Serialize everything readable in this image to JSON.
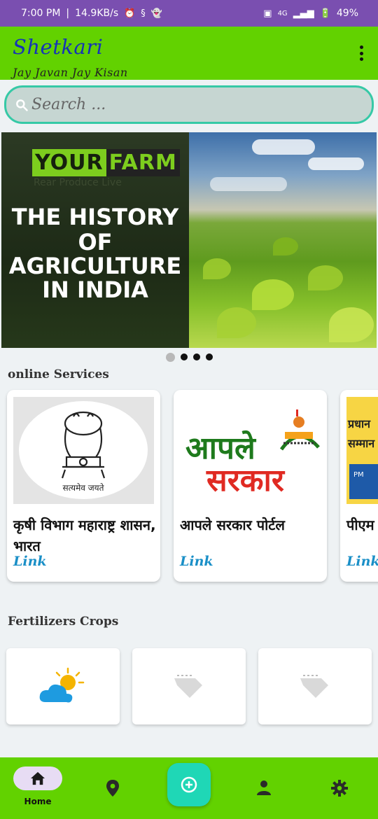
{
  "status_bar": {
    "time": "7:00 PM",
    "net_speed": "14.9KB/s",
    "signal": "4G",
    "battery": "49%"
  },
  "app_bar": {
    "title": "Shetkari",
    "subtitle": "Jay Javan Jay Kisan",
    "menu_icon": "more-vert-icon"
  },
  "search": {
    "placeholder": "Search ...",
    "value": "",
    "icon": "search-icon"
  },
  "banner": {
    "brand_left": "YOUR",
    "brand_right": "FARM",
    "brand_tagline": "Rear Produce Live",
    "headline": [
      "THE HISTORY",
      "OF",
      "AGRICULTURE",
      "IN INDIA"
    ],
    "pager": {
      "total": 4,
      "active": 0
    }
  },
  "online_services": {
    "title": "online Services",
    "items": [
      {
        "name": "कृषी विभाग महाराष्ट्र शासन, भारत",
        "link": "Link",
        "image": "emblem-of-india",
        "image_caption": "सत्यमेव जयते"
      },
      {
        "name": "आपले सरकार पोर्टल",
        "link": "Link",
        "image": "aaple-sarkar-logo",
        "logo_line1": "आपले",
        "logo_line2": "सरकार"
      },
      {
        "name": "पीएम निधी",
        "link": "Link",
        "image": "pm-kisan-logo",
        "logo_line1": "प्रधान",
        "logo_line2": "सम्मान"
      }
    ]
  },
  "fertilizers_crops": {
    "title": "Fertilizers Crops",
    "items": [
      {
        "icon": "weather-icon"
      },
      {
        "icon": "broken-image-icon"
      },
      {
        "icon": "broken-image-icon"
      }
    ]
  },
  "bottom_nav": {
    "items": [
      {
        "label": "Home",
        "icon": "home-icon",
        "active": true
      },
      {
        "label": "",
        "icon": "location-icon"
      },
      {
        "label": "",
        "icon": "add-circle-icon",
        "fab": true
      },
      {
        "label": "",
        "icon": "person-icon"
      },
      {
        "label": "",
        "icon": "settings-icon"
      }
    ]
  },
  "colors": {
    "status_bar": "#7a4fb0",
    "app_bar": "#62d200",
    "title": "#1533b8",
    "search_border": "#36c9a6",
    "link": "#1a8fc7",
    "fab": "#1fd7b6"
  }
}
